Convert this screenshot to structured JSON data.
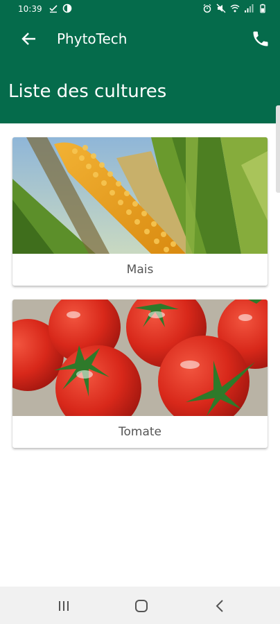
{
  "status_bar": {
    "time": "10:39"
  },
  "app_bar": {
    "title": "PhytoTech",
    "page_title": "Liste des cultures",
    "color": "#056b4b"
  },
  "crops": [
    {
      "name": "Mais",
      "image": "corn-photo"
    },
    {
      "name": "Tomate",
      "image": "tomato-photo"
    }
  ],
  "icons": {
    "back": "arrow-back-icon",
    "call": "phone-icon",
    "nav_recents": "recents-icon",
    "nav_home": "home-icon",
    "nav_back": "back-chevron-icon"
  }
}
